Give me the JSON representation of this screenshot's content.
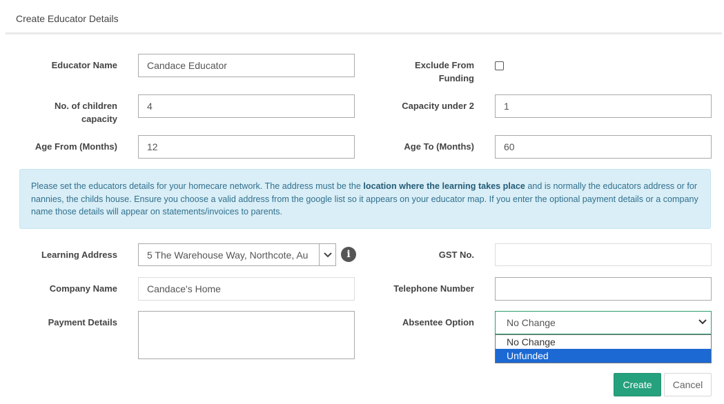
{
  "header": {
    "title": "Create Educator Details"
  },
  "fields": {
    "educator_name": {
      "label": "Educator Name",
      "value": "Candace Educator"
    },
    "exclude_from_funding": {
      "label_line1": "Exclude From",
      "label_line2": "Funding",
      "checked": false
    },
    "children_capacity": {
      "label_line1": "No. of children",
      "label_line2": "capacity",
      "value": "4"
    },
    "capacity_under_2": {
      "label": "Capacity under 2",
      "value": "1"
    },
    "age_from": {
      "label": "Age From (Months)",
      "value": "12"
    },
    "age_to": {
      "label": "Age To (Months)",
      "value": "60"
    },
    "learning_address": {
      "label": "Learning Address",
      "value": "5 The Warehouse Way, Northcote, Au"
    },
    "gst_no": {
      "label": "GST No.",
      "value": ""
    },
    "company_name": {
      "label": "Company Name",
      "value": "Candace's Home"
    },
    "telephone": {
      "label": "Telephone Number",
      "value": ""
    },
    "payment_details": {
      "label": "Payment Details",
      "value": ""
    },
    "absentee_option": {
      "label": "Absentee Option",
      "selected": "No Change",
      "options": [
        "No Change",
        "Unfunded"
      ],
      "highlighted": "Unfunded"
    }
  },
  "info": {
    "text_before": "Please set the educators details for your homecare network. The address must be the ",
    "bold": "location where the learning takes place",
    "text_after": " and is normally the educators address or for nannies, the childs house. Ensure you choose a valid address from the google list so it appears on your educator map. If you enter the optional payment details or a company name those details will appear on statements/invoices to parents."
  },
  "buttons": {
    "create": "Create",
    "cancel": "Cancel"
  },
  "icons": {
    "address_dropdown": "chevron-down-icon",
    "address_info": "info-icon",
    "select_caret": "chevron-down-icon"
  },
  "colors": {
    "primary": "#26a17d",
    "info_bg": "#d9eef6",
    "highlight": "#1c69d3"
  }
}
